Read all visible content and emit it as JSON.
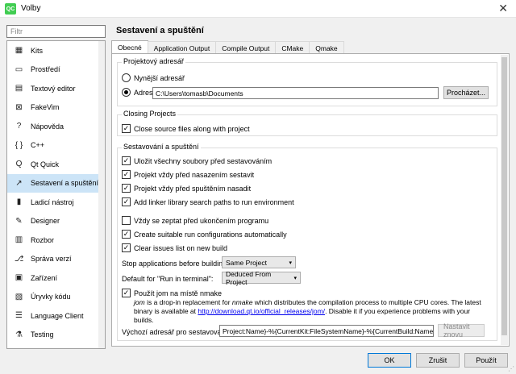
{
  "window": {
    "title": "Volby",
    "app_icon": "QC"
  },
  "filter_placeholder": "Filtr",
  "sidebar": {
    "items": [
      {
        "label": "Kits",
        "icon": "kits-icon",
        "glyph": "▦"
      },
      {
        "label": "Prostředí",
        "icon": "monitor-icon",
        "glyph": "▭"
      },
      {
        "label": "Textový editor",
        "icon": "text-editor-icon",
        "glyph": "▤"
      },
      {
        "label": "FakeVim",
        "icon": "fakevim-icon",
        "glyph": "⊠"
      },
      {
        "label": "Nápověda",
        "icon": "help-icon",
        "glyph": "?"
      },
      {
        "label": "C++",
        "icon": "cpp-icon",
        "glyph": "{ }"
      },
      {
        "label": "Qt Quick",
        "icon": "qt-quick-icon",
        "glyph": "Q"
      },
      {
        "label": "Sestavení a spuštění",
        "icon": "build-run-icon",
        "glyph": "↗",
        "selected": true
      },
      {
        "label": "Ladicí nástroj",
        "icon": "debugger-icon",
        "glyph": "▮"
      },
      {
        "label": "Designer",
        "icon": "designer-icon",
        "glyph": "✎"
      },
      {
        "label": "Rozbor",
        "icon": "analyzer-icon",
        "glyph": "▥"
      },
      {
        "label": "Správa verzí",
        "icon": "version-control-icon",
        "glyph": "⎇"
      },
      {
        "label": "Zařízení",
        "icon": "devices-icon",
        "glyph": "▣"
      },
      {
        "label": "Úryvky kódu",
        "icon": "snippets-icon",
        "glyph": "▧"
      },
      {
        "label": "Language Client",
        "icon": "language-client-icon",
        "glyph": "☰"
      },
      {
        "label": "Testing",
        "icon": "testing-icon",
        "glyph": "⚗"
      }
    ]
  },
  "main": {
    "title": "Sestavení a spuštění",
    "tabs": [
      "Obecné",
      "Application Output",
      "Compile Output",
      "CMake",
      "Qmake"
    ],
    "project_dir": {
      "title": "Projektový adresář",
      "current_label": "Nynější adresář",
      "dir_label": "Adresář",
      "dir_value": "C:\\Users\\tomasb\\Documents",
      "browse_label": "Procházet..."
    },
    "closing": {
      "title": "Closing Projects",
      "close_sources": "Close source files along with project"
    },
    "build_run": {
      "title": "Sestavování a spuštění",
      "save_all": "Uložit všechny soubory před sestavováním",
      "build_before_deploy": "Projekt vždy před nasazením sestavit",
      "deploy_before_run": "Projekt vždy před spuštěním nasadit",
      "linker_paths": "Add linker library search paths to run environment",
      "ask_before_stop": "Vždy se zeptat před ukončením programu",
      "create_run_configs": "Create suitable run configurations automatically",
      "clear_issues": "Clear issues list on new build",
      "stop_label": "Stop applications before building:",
      "stop_value": "Same Project",
      "terminal_label": "Default for \"Run in terminal\":",
      "terminal_value": "Deduced From Project",
      "jom_label": "Použít jom na místě nmake",
      "jom_desc_jom": "jom",
      "jom_desc_1": " is a drop-in replacement for ",
      "jom_desc_nmake": "nmake",
      "jom_desc_2": " which distributes the compilation process to multiple CPU cores. The latest binary is available at ",
      "jom_link": "http://download.qt.io/official_releases/jom/",
      "jom_desc_3": ". Disable it if you experience problems with your builds.",
      "build_dir_label": "Výchozí adresář pro sestavování:",
      "build_dir_value": "Project:Name}-%{CurrentKit:FileSystemName}-%{CurrentBuild:Name}\"}",
      "reset_label": "Nastavit znovu"
    }
  },
  "buttons": {
    "ok": "OK",
    "cancel": "Zrušit",
    "apply": "Použít"
  },
  "colors": {
    "selection": "#cce4f7",
    "accent": "#0078d7",
    "link": "#0000ee"
  }
}
